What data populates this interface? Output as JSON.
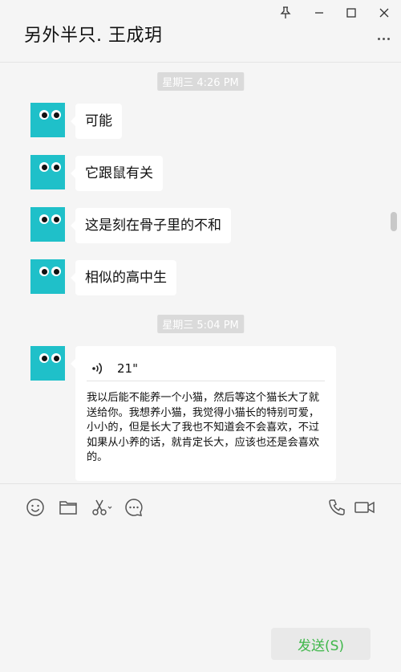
{
  "header": {
    "title": "另外半只. 王成玥",
    "window_controls": [
      "pin-icon",
      "minimize-icon",
      "maximize-icon",
      "close-icon"
    ],
    "more_icon": "more-dots-icon"
  },
  "messages": {
    "timestamp_1": "星期三 4:26 PM",
    "msg_1": "可能",
    "msg_2": "它跟鼠有关",
    "msg_3": "这是刻在骨子里的不和",
    "msg_4": "相似的高中生",
    "timestamp_2": "星期三 5:04 PM",
    "voice": {
      "duration": "21\"",
      "transcript": "我以后能不能养一个小猫，然后等这个猫长大了就送给你。我想养小猫，我觉得小猫长的特别可爱，小小的，但是长大了我也不知道会不会喜欢，不过如果从小养的话，就肯定长大，应该也还是会喜欢的。"
    }
  },
  "toolbar": {
    "left_icons": [
      "emoji-icon",
      "folder-icon",
      "scissors-icon",
      "chat-history-icon"
    ],
    "right_icons": [
      "phone-icon",
      "video-call-icon"
    ],
    "send_label": "发送(S)"
  },
  "colors": {
    "background": "#f5f5f5",
    "avatar": "#1fc0c9",
    "send_text": "#3fb74a",
    "timestamp_bg": "#dadada"
  }
}
